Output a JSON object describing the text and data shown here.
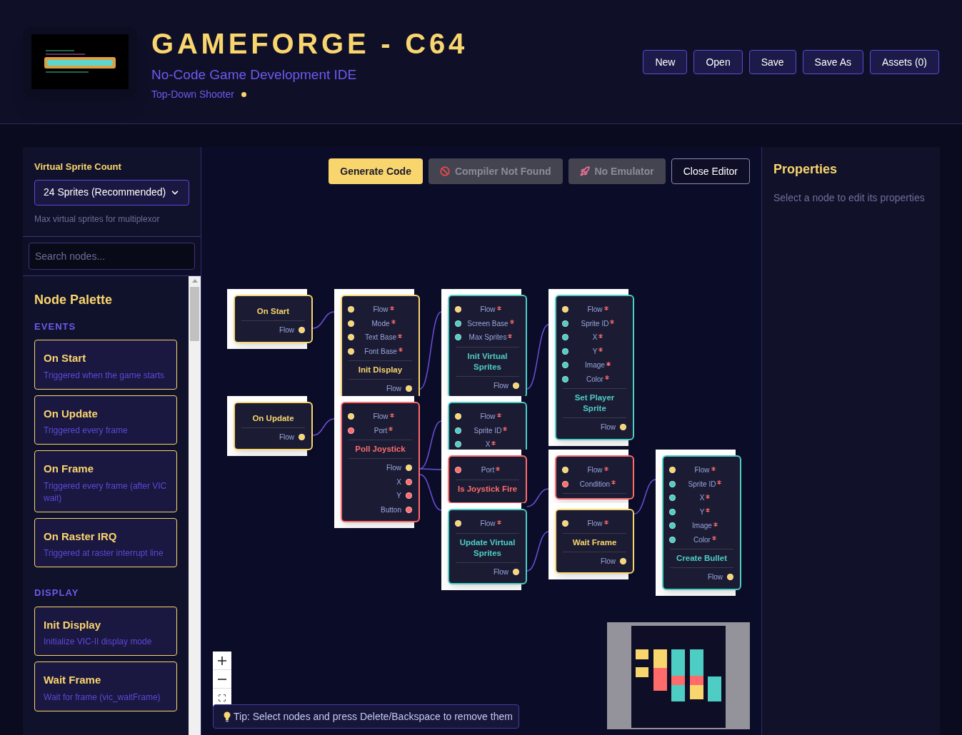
{
  "header": {
    "title": "GAMEFORGE - C64",
    "subtitle": "No-Code Game Development IDE",
    "project": "Top-Down Shooter",
    "unsaved": true,
    "buttons": [
      "New",
      "Open",
      "Save",
      "Save As",
      "Assets (0)"
    ]
  },
  "sidebar": {
    "sprite_count": {
      "label": "Virtual Sprite Count",
      "value": "24 Sprites (Recommended)",
      "hint": "Max virtual sprites for multiplexor"
    },
    "search": {
      "placeholder": "Search nodes..."
    },
    "palette": {
      "title": "Node Palette",
      "sections": [
        {
          "name": "EVENTS",
          "items": [
            {
              "title": "On Start",
              "description": "Triggered when the game starts"
            },
            {
              "title": "On Update",
              "description": "Triggered every frame"
            },
            {
              "title": "On Frame",
              "description": "Triggered every frame (after VIC wait)"
            },
            {
              "title": "On Raster IRQ",
              "description": "Triggered at raster interrupt line"
            }
          ]
        },
        {
          "name": "DISPLAY",
          "items": [
            {
              "title": "Init Display",
              "description": "Initialize VIC-II display mode"
            },
            {
              "title": "Wait Frame",
              "description": "Wait for frame (vic_waitFrame)"
            }
          ]
        }
      ]
    }
  },
  "toolbar": [
    {
      "label": "Generate Code",
      "kind": "primary",
      "disabled": false
    },
    {
      "label": "Compiler Not Found",
      "kind": "status",
      "disabled": true
    },
    {
      "label": "No Emulator",
      "kind": "status",
      "disabled": true
    },
    {
      "label": "Close Editor",
      "kind": "outline",
      "disabled": false
    }
  ],
  "nodes": [
    {
      "title": "On Start",
      "color": "#f9d56e",
      "outputs": [
        {
          "label": "Flow",
          "kind": "flow"
        }
      ]
    },
    {
      "title": "On Update",
      "color": "#f9d56e",
      "outputs": [
        {
          "label": "Flow",
          "kind": "flow"
        }
      ]
    },
    {
      "title": "Init Display",
      "color": "#f9d56e",
      "inputs": [
        {
          "label": "Flow",
          "kind": "flow",
          "required": true
        },
        {
          "label": "Mode",
          "kind": "data",
          "required": true
        },
        {
          "label": "Text Base",
          "kind": "data",
          "required": true
        },
        {
          "label": "Font Base",
          "kind": "data",
          "required": true
        }
      ],
      "outputs": [
        {
          "label": "Flow",
          "kind": "flow"
        }
      ]
    },
    {
      "title": "Poll Joystick",
      "color": "#ff6b6b",
      "inputs": [
        {
          "label": "Flow",
          "kind": "flow",
          "required": true
        },
        {
          "label": "Port",
          "kind": "data",
          "required": true
        }
      ],
      "outputs": [
        {
          "label": "Flow",
          "kind": "flow"
        },
        {
          "label": "X",
          "kind": "data"
        },
        {
          "label": "Y",
          "kind": "data"
        },
        {
          "label": "Button",
          "kind": "data"
        }
      ]
    },
    {
      "title": "Init Virtual Sprites",
      "color": "#4ecdc4",
      "inputs": [
        {
          "label": "Flow",
          "kind": "flow",
          "required": true
        },
        {
          "label": "Screen Base",
          "kind": "data",
          "required": true
        },
        {
          "label": "Max Sprites",
          "kind": "data",
          "required": true
        }
      ],
      "outputs": [
        {
          "label": "Flow",
          "kind": "flow"
        }
      ]
    },
    {
      "color": "#4ecdc4",
      "inputs": [
        {
          "label": "Flow",
          "kind": "flow",
          "required": true
        },
        {
          "label": "Sprite ID",
          "kind": "data",
          "required": true
        },
        {
          "label": "X",
          "kind": "data",
          "required": true
        }
      ]
    },
    {
      "title": "Is Joystick Fire",
      "color": "#ff6b6b",
      "inputs": [
        {
          "label": "Port",
          "kind": "data",
          "required": true
        }
      ]
    },
    {
      "title": "Update Virtual Sprites",
      "color": "#4ecdc4",
      "inputs": [
        {
          "label": "Flow",
          "kind": "flow",
          "required": true
        }
      ],
      "outputs": [
        {
          "label": "Flow",
          "kind": "flow"
        }
      ]
    },
    {
      "title": "Set Player Sprite",
      "color": "#4ecdc4",
      "inputs": [
        {
          "label": "Flow",
          "kind": "flow",
          "required": true
        },
        {
          "label": "Sprite ID",
          "kind": "data",
          "required": true
        },
        {
          "label": "X",
          "kind": "data",
          "required": true
        },
        {
          "label": "Y",
          "kind": "data",
          "required": true
        },
        {
          "label": "Image",
          "kind": "data",
          "required": true
        },
        {
          "label": "Color",
          "kind": "data",
          "required": true
        }
      ],
      "outputs": [
        {
          "label": "Flow",
          "kind": "flow"
        }
      ]
    },
    {
      "color": "#ff6b6b",
      "inputs": [
        {
          "label": "Flow",
          "kind": "flow",
          "required": true
        },
        {
          "label": "Condition",
          "kind": "data",
          "required": true
        }
      ]
    },
    {
      "title": "Wait Frame",
      "color": "#f9d56e",
      "inputs": [
        {
          "label": "Flow",
          "kind": "flow",
          "required": true
        }
      ],
      "outputs": [
        {
          "label": "Flow",
          "kind": "flow"
        }
      ]
    },
    {
      "title": "Create Bullet",
      "color": "#4ecdc4",
      "inputs": [
        {
          "label": "Flow",
          "kind": "flow",
          "required": true
        },
        {
          "label": "Sprite ID",
          "kind": "data",
          "required": true
        },
        {
          "label": "X",
          "kind": "data",
          "required": true
        },
        {
          "label": "Y",
          "kind": "data",
          "required": true
        },
        {
          "label": "Image",
          "kind": "data",
          "required": true
        },
        {
          "label": "Color",
          "kind": "data",
          "required": true
        }
      ],
      "outputs": [
        {
          "label": "Flow",
          "kind": "flow"
        }
      ]
    }
  ],
  "tip": "Tip: Select nodes and press Delete/Backspace to remove them",
  "properties": {
    "title": "Properties",
    "empty_text": "Select a node to edit its properties"
  }
}
